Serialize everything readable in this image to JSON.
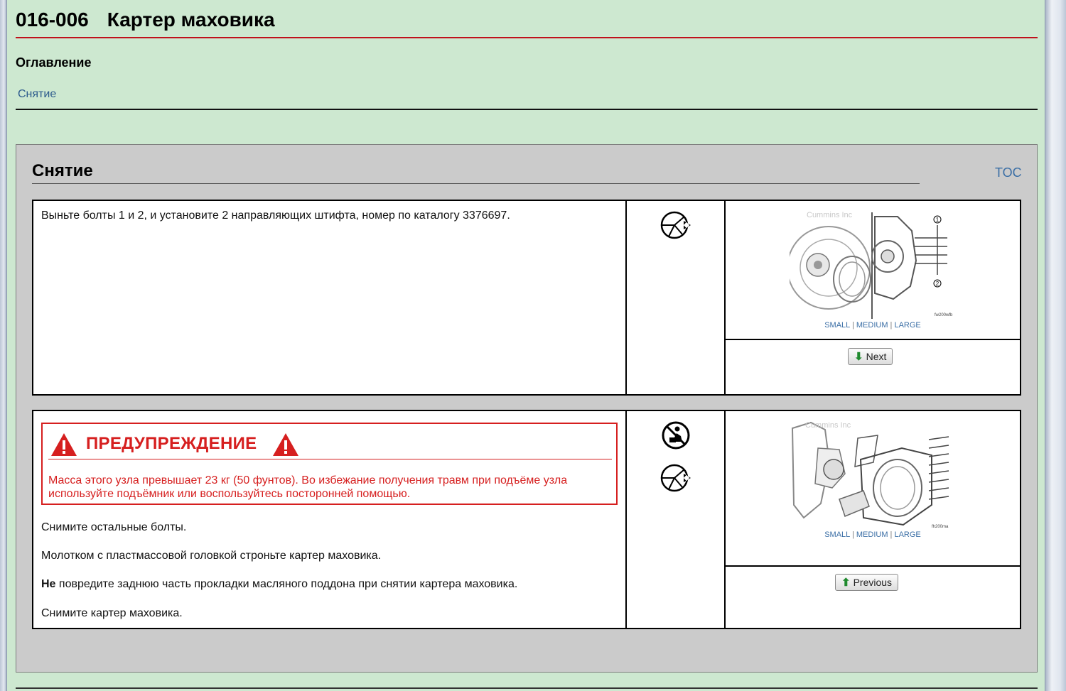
{
  "header": {
    "doc_number": "016-006",
    "doc_title": "Картер маховика"
  },
  "toc": {
    "heading": "Оглавление",
    "items": [
      "Снятие"
    ]
  },
  "section": {
    "title": "Снятие",
    "toc_link": "TOC"
  },
  "step1": {
    "text": "Выньте болты 1 и 2, и установите 2 направляющих штифта, номер по каталогу 3376697.",
    "icons": [
      "tool-icon"
    ],
    "image": {
      "watermark": "Cummins Inc",
      "code": "fw200wfb",
      "callouts": [
        "1",
        "2"
      ]
    },
    "sizes": [
      "SMALL",
      "MEDIUM",
      "LARGE"
    ],
    "separator": "|",
    "button": "Next"
  },
  "step2": {
    "warning": {
      "title": "ПРЕДУПРЕЖДЕНИЕ",
      "text": "Масса этого узла превышает 23 кг (50 фунтов). Во избежание получения травм при подъёме узла используйте подъёмник или воспользуйтесь посторонней помощью."
    },
    "p1": "Снимите остальные болты.",
    "p2": "Молотком с пластмассовой головкой строньте картер маховика.",
    "p3_bold": "Не",
    "p3_rest": " повредите заднюю часть прокладки масляного поддона при снятии картера маховика.",
    "p4": "Снимите картер маховика.",
    "icons": [
      "heavy-lift-icon",
      "tool-icon"
    ],
    "image": {
      "watermark": "Cummins Inc",
      "code": "fh200ma"
    },
    "sizes": [
      "SMALL",
      "MEDIUM",
      "LARGE"
    ],
    "separator": "|",
    "button": "Previous"
  },
  "colors": {
    "background": "#cde8d0",
    "title_rule": "#c0111b",
    "warning": "#d61f1f",
    "link": "#3a6ea5",
    "panel": "#cbcbcb"
  }
}
